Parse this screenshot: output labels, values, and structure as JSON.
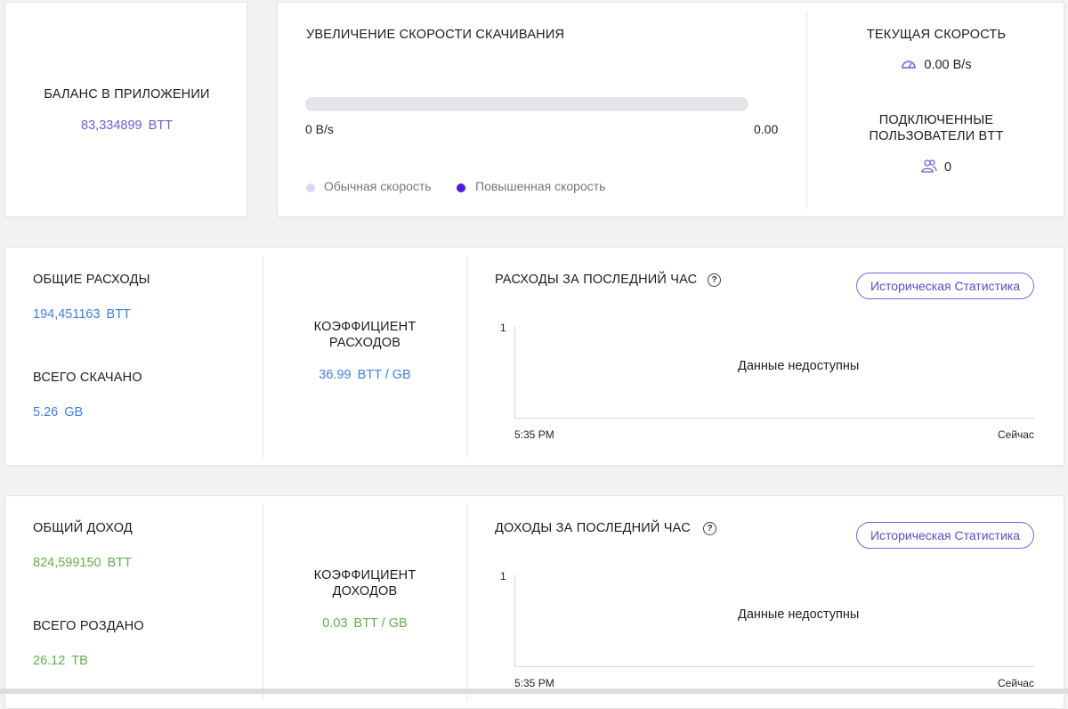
{
  "balance": {
    "title": "БАЛАНС В ПРИЛОЖЕНИИ",
    "value": "83,334899",
    "unit": "BTT"
  },
  "speed_boost": {
    "title": "УВЕЛИЧЕНИЕ СКОРОСТИ СКАЧИВАНИЯ",
    "progress_fraction": 0.0,
    "left_label": "0 B/s",
    "right_label": "0.00",
    "legend": [
      {
        "label": "Обычная скорость",
        "color": "#d9d5f6"
      },
      {
        "label": "Повышенная скорость",
        "color": "#4a1be3"
      }
    ]
  },
  "current_speed": {
    "title": "ТЕКУЩАЯ СКОРОСТЬ",
    "icon": "speedometer-icon",
    "value": "0.00 B/s"
  },
  "connected_users": {
    "title_line1": "ПОДКЛЮЧЕННЫЕ",
    "title_line2": "ПОЛЬЗОВАТЕЛИ BTT",
    "icon": "users-icon",
    "value": "0"
  },
  "expenses": {
    "total_title": "ОБЩИЕ РАСХОДЫ",
    "total_value": "194,451163",
    "total_unit": "BTT",
    "downloaded_title": "ВСЕГО СКАЧАНО",
    "downloaded_value": "5.26",
    "downloaded_unit": "GB",
    "ratio_title_line1": "КОЭФФИЦИЕНТ",
    "ratio_title_line2": "РАСХОДОВ",
    "ratio_value": "36.99",
    "ratio_unit": "BTT / GB",
    "chart_title": "РАСХОДЫ ЗА ПОСЛЕДНИЙ ЧАС",
    "history_button": "Историческая Статистика",
    "y_tick": "1",
    "no_data": "Данные недоступны",
    "x_start": "5:35 PM",
    "x_end": "Сейчас"
  },
  "income": {
    "total_title": "ОБЩИЙ ДОХОД",
    "total_value": "824,599150",
    "total_unit": "BTT",
    "uploaded_title": "ВСЕГО РОЗДАНО",
    "uploaded_value": "26.12",
    "uploaded_unit": "TB",
    "ratio_title_line1": "КОЭФФИЦИЕНТ",
    "ratio_title_line2": "ДОХОДОВ",
    "ratio_value": "0.03",
    "ratio_unit": "BTT / GB",
    "chart_title": "ДОХОДЫ ЗА ПОСЛЕДНИЙ ЧАС",
    "history_button": "Историческая Статистика",
    "y_tick": "1",
    "no_data": "Данные недоступны",
    "x_start": "5:35 PM",
    "x_end": "Сейчас"
  },
  "colors": {
    "accent_purple": "#6f5ce4",
    "expense_blue": "#3f7fe6",
    "income_green": "#62b046"
  }
}
